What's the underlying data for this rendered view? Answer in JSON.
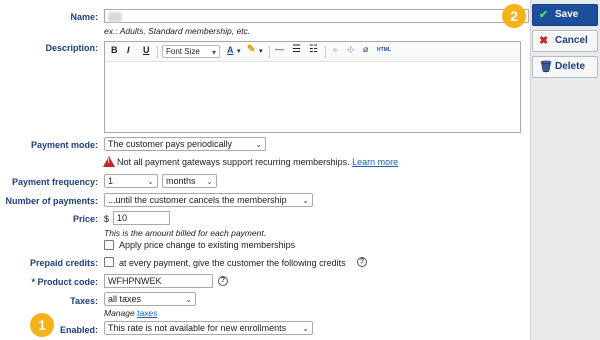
{
  "form": {
    "name": {
      "label": "Name:",
      "hint": "ex.: Adults, Standard membership, etc."
    },
    "description": {
      "label": "Description:",
      "toolbar": {
        "bold": "B",
        "italic": "I",
        "underline": "U",
        "font_size": "Font Size",
        "text_color": "A",
        "html": "HTML"
      }
    },
    "payment_mode": {
      "label": "Payment mode:",
      "value": "The customer pays periodically",
      "warning": "Not all payment gateways support recurring memberships.",
      "learn_more": "Learn more"
    },
    "payment_frequency": {
      "label": "Payment frequency:",
      "count": "1",
      "unit": "months"
    },
    "number_of_payments": {
      "label": "Number of payments:",
      "value": "...until the customer cancels the membership"
    },
    "price": {
      "label": "Price:",
      "currency": "$",
      "value": "10",
      "hint": "This is the amount billed for each payment.",
      "apply_label": "Apply price change to existing memberships"
    },
    "prepaid_credits": {
      "label": "Prepaid credits:",
      "text": "at every payment, give the customer the following credits"
    },
    "product_code": {
      "label": "* Product code:",
      "value": "WFHPNWEK"
    },
    "taxes": {
      "label": "Taxes:",
      "value": "all taxes",
      "manage_prefix": "Manage",
      "manage_link": "taxes"
    },
    "enabled": {
      "label": "Enabled:",
      "value": "This rate is not available for new enrollments"
    }
  },
  "actions": {
    "save": "Save",
    "cancel": "Cancel",
    "delete": "Delete"
  },
  "badges": {
    "one": "1",
    "two": "2"
  },
  "colors": {
    "accent": "#1d4e9c",
    "badge": "#f5b21b",
    "warning": "#c62828",
    "label": "#1f3f7a"
  }
}
